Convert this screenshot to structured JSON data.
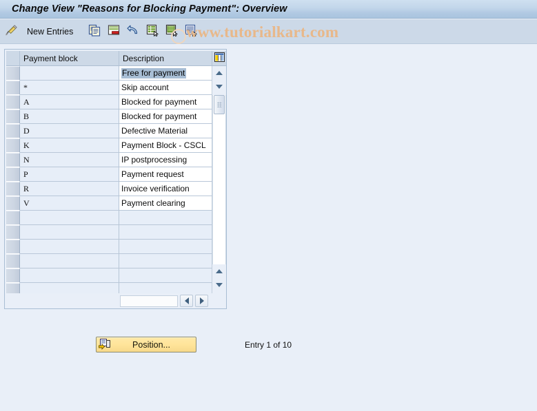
{
  "window": {
    "title": "Change View \"Reasons for Blocking Payment\": Overview"
  },
  "toolbar": {
    "pencil_icon": "pencil-display-change-icon",
    "new_entries_label": "New Entries",
    "buttons": [
      {
        "icon": "copy-as-icon",
        "name": "copy-as-button"
      },
      {
        "icon": "delete-row-icon",
        "name": "delete-button"
      },
      {
        "icon": "undo-icon",
        "name": "undo-button"
      },
      {
        "icon": "select-all-icon",
        "name": "select-all-button"
      },
      {
        "icon": "deselect-all-icon",
        "name": "deselect-all-button"
      },
      {
        "icon": "select-block-icon",
        "name": "select-block-button"
      }
    ],
    "watermark": "www.tutorialkart.com"
  },
  "table": {
    "columns": [
      {
        "key": "select",
        "label": ""
      },
      {
        "key": "payment_block",
        "label": "Payment block"
      },
      {
        "key": "description",
        "label": "Description"
      }
    ],
    "config_icon": "table-settings-icon",
    "rows": [
      {
        "payment_block": "",
        "description": "Free for payment",
        "selected": true
      },
      {
        "payment_block": "*",
        "description": "Skip account",
        "selected": false
      },
      {
        "payment_block": "A",
        "description": "Blocked for payment",
        "selected": false
      },
      {
        "payment_block": "B",
        "description": "Blocked for payment",
        "selected": false
      },
      {
        "payment_block": "D",
        "description": "Defective Material",
        "selected": false
      },
      {
        "payment_block": "K",
        "description": "Payment Block - CSCL",
        "selected": false
      },
      {
        "payment_block": "N",
        "description": "IP postprocessing",
        "selected": false
      },
      {
        "payment_block": "P",
        "description": "Payment request",
        "selected": false
      },
      {
        "payment_block": "R",
        "description": "Invoice verification",
        "selected": false
      },
      {
        "payment_block": "V",
        "description": "Payment clearing",
        "selected": false
      }
    ],
    "empty_row_count": 6,
    "scroll": {
      "up_icon": "scroll-up-icon",
      "down_icon": "scroll-down-icon",
      "thumb_icon": "scrollbar-thumb-grip",
      "left_icon": "scroll-left-icon",
      "right_icon": "scroll-right-icon"
    }
  },
  "footer": {
    "position_label": "Position...",
    "position_icon": "position-goto-icon",
    "entry_status": "Entry 1 of 10"
  },
  "colors": {
    "title_bar": "#bcd3e8",
    "toolbar": "#ccd9e8",
    "page_bg": "#e9eff8",
    "header_cell": "#cdd9e7",
    "row_alt": "#e7eef8",
    "selection": "#a7bdd4",
    "button_yellow": "#ffe49a",
    "watermark": "#e8b88a"
  }
}
